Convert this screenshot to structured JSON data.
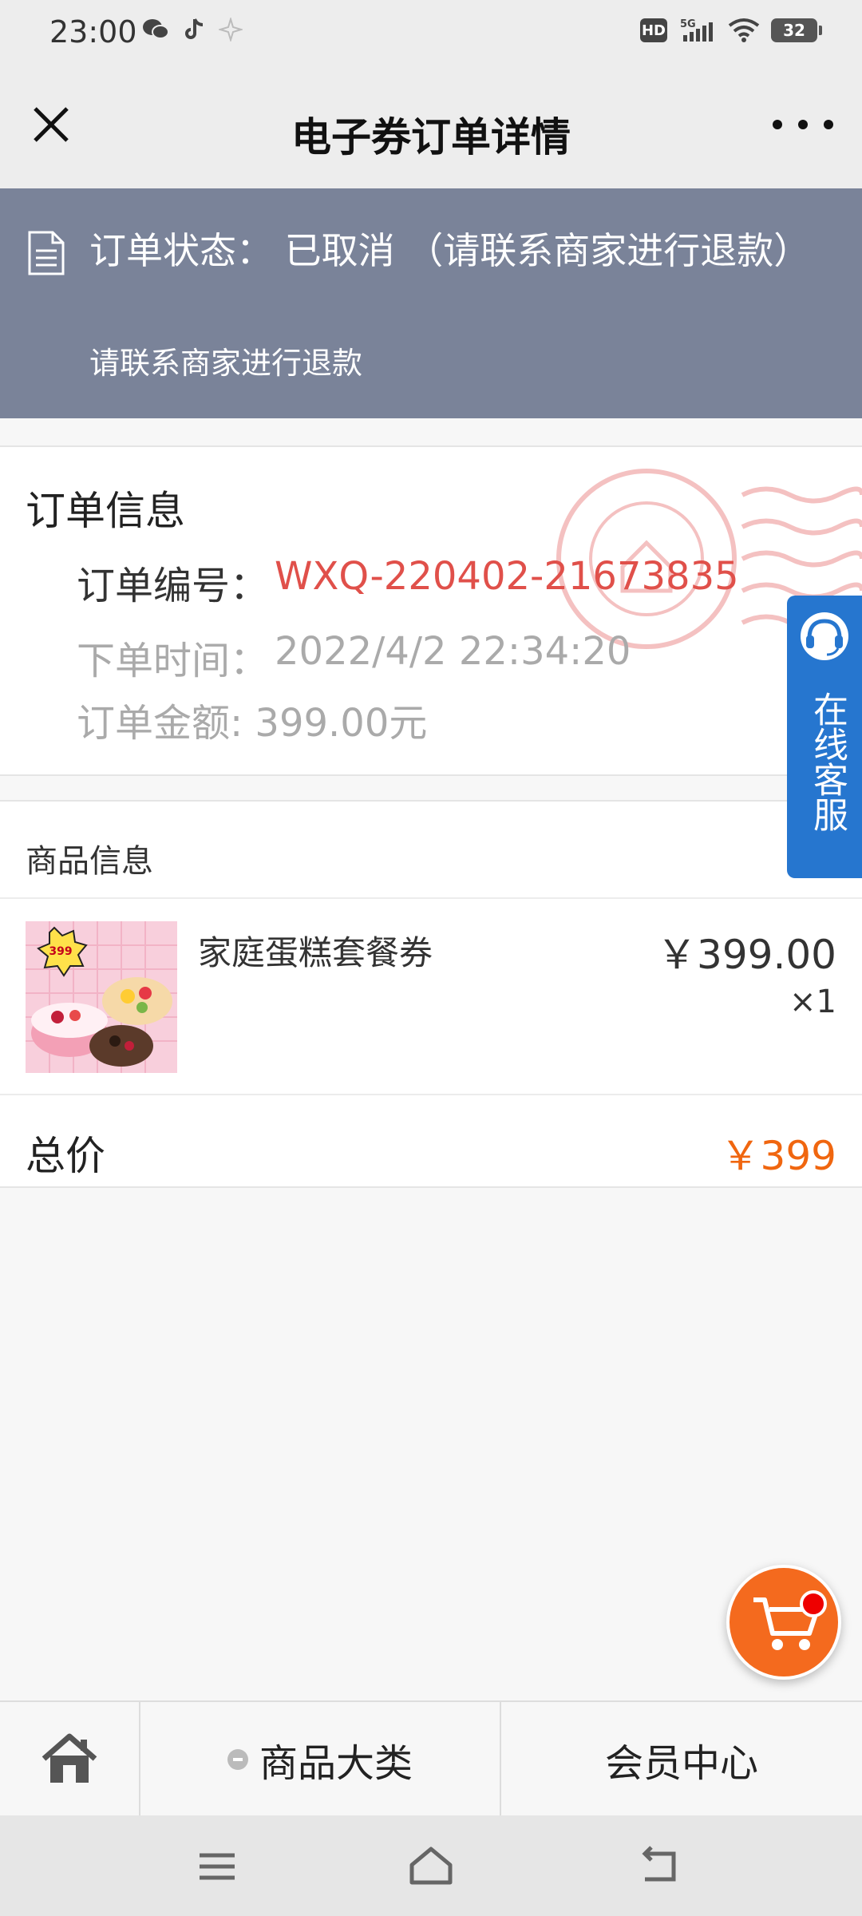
{
  "status_bar": {
    "time": "23:00",
    "apps": [
      "wechat-icon",
      "tiktok-icon",
      "sparkle-icon"
    ],
    "hd": "HD",
    "network": "5G",
    "battery": "32"
  },
  "nav": {
    "title": "电子券订单详情"
  },
  "order_status": {
    "main": "订单状态： 已取消 （请联系商家进行退款）",
    "sub": "请联系商家进行退款"
  },
  "order_info": {
    "title": "订单信息",
    "number_label": "订单编号：",
    "number_value": "WXQ-220402-21673835",
    "time_label": "下单时间：",
    "time_value": "2022/4/2 22:34:20",
    "amount": "订单金额: 399.00元"
  },
  "goods": {
    "title": "商品信息",
    "items": [
      {
        "name": "家庭蛋糕套餐券",
        "price": "￥399.00",
        "qty": "×1",
        "image_badge": "399"
      }
    ],
    "total_label": "总价",
    "total_value": "￥399"
  },
  "service": {
    "label": "在线客服"
  },
  "bottom_nav": {
    "category": "商品大类",
    "member": "会员中心"
  },
  "colors": {
    "status_banner": "#7a8399",
    "order_number": "#e0504a",
    "total_price": "#f0660f",
    "service": "#2676cf",
    "cart": "#f46a1e"
  }
}
